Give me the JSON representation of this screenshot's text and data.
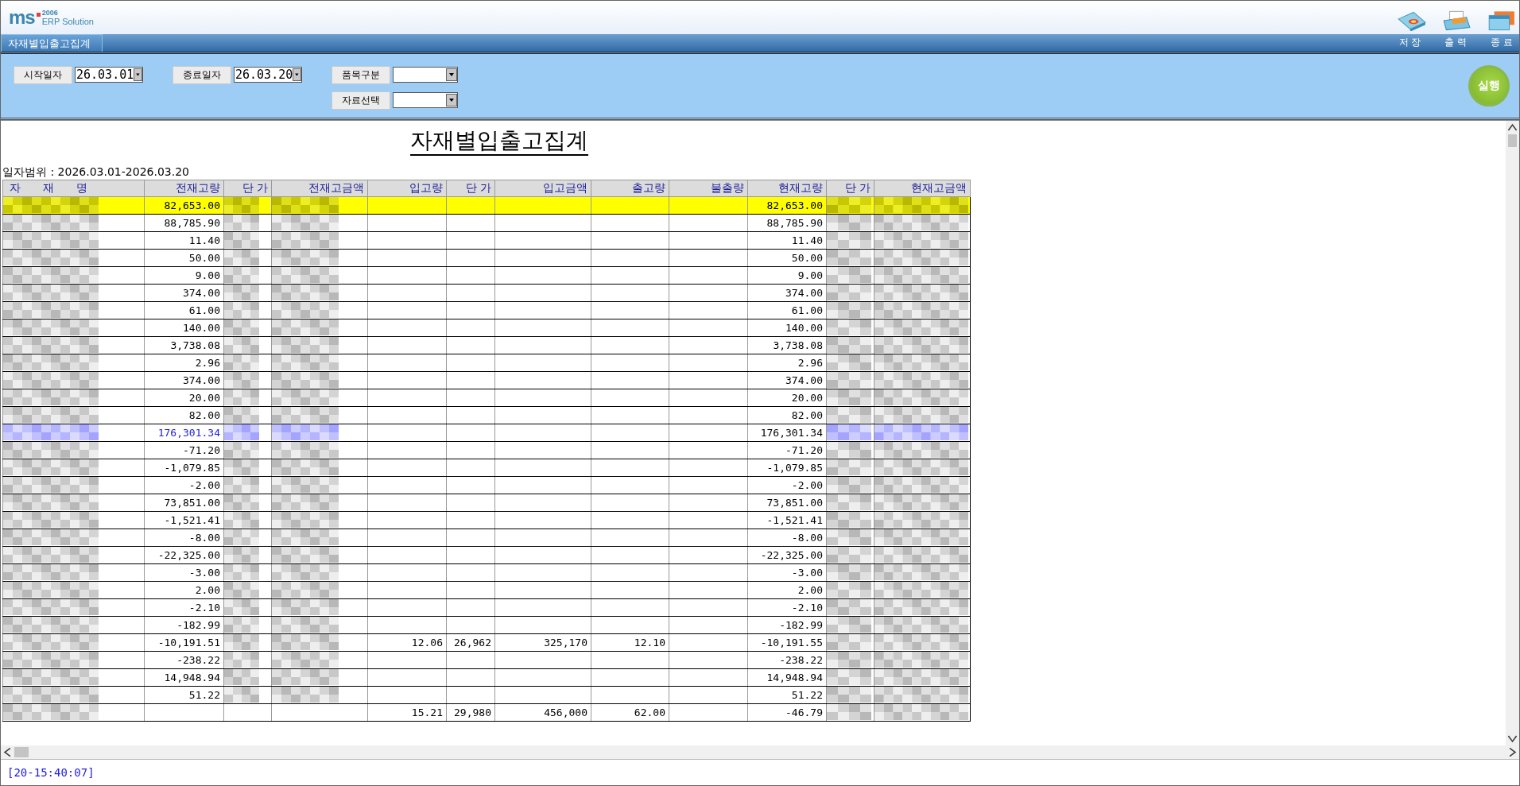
{
  "logo": {
    "mark": "ms",
    "year": "2006",
    "product": "ERP Solution"
  },
  "toolbar": [
    {
      "kind": "save",
      "label": "저 장"
    },
    {
      "kind": "print",
      "label": "출 력"
    },
    {
      "kind": "exit",
      "label": "종 료"
    }
  ],
  "tabs": [
    {
      "label": "자재별입출고집계",
      "selected": true
    }
  ],
  "filters": [
    {
      "label": "시작일자",
      "value": "26.03.01",
      "kind": "combo"
    },
    {
      "label": "종료일자",
      "value": "26.03.20",
      "kind": "combo"
    },
    {
      "label": "품목구분",
      "kind": "combo"
    },
    {
      "label": "자료선택",
      "kind": "combo"
    }
  ],
  "run_button": "실행",
  "report": {
    "title": "자재별입출고집계",
    "date_range": "일자범위 : 2026.03.01-2026.03.20",
    "columns": [
      "자　　재　　명",
      "전재고량",
      "단 가",
      "전재고금액",
      "입고량",
      "단 가",
      "입고금액",
      "출고량",
      "불출량",
      "현재고량",
      "단 가",
      "현재고금액"
    ],
    "rows": [
      {
        "selected": true,
        "kind": "item",
        "prev_qty": "82,653.00",
        "cur_qty": "82,653.00"
      },
      {
        "selected": false,
        "kind": "item",
        "prev_qty": "88,785.90",
        "cur_qty": "88,785.90"
      },
      {
        "selected": false,
        "kind": "item",
        "prev_qty": "11.40",
        "cur_qty": "11.40"
      },
      {
        "selected": false,
        "kind": "item",
        "prev_qty": "50.00",
        "cur_qty": "50.00"
      },
      {
        "selected": false,
        "kind": "item",
        "prev_qty": "9.00",
        "cur_qty": "9.00"
      },
      {
        "selected": false,
        "kind": "item",
        "prev_qty": "374.00",
        "cur_qty": "374.00"
      },
      {
        "selected": false,
        "kind": "item",
        "prev_qty": "61.00",
        "cur_qty": "61.00"
      },
      {
        "selected": false,
        "kind": "item",
        "prev_qty": "140.00",
        "cur_qty": "140.00"
      },
      {
        "selected": false,
        "kind": "item",
        "prev_qty": "3,738.08",
        "cur_qty": "3,738.08"
      },
      {
        "selected": false,
        "kind": "item",
        "prev_qty": "2.96",
        "cur_qty": "2.96"
      },
      {
        "selected": false,
        "kind": "item",
        "prev_qty": "374.00",
        "cur_qty": "374.00"
      },
      {
        "selected": false,
        "kind": "item",
        "prev_qty": "20.00",
        "cur_qty": "20.00"
      },
      {
        "selected": false,
        "kind": "item",
        "prev_qty": "82.00",
        "cur_qty": "82.00"
      },
      {
        "selected": false,
        "kind": "subtotal",
        "prev_qty": "176,301.34",
        "cur_qty": "176,301.34"
      },
      {
        "selected": false,
        "kind": "item",
        "prev_qty": "-71.20",
        "cur_qty": "-71.20"
      },
      {
        "selected": false,
        "kind": "item",
        "prev_qty": "-1,079.85",
        "cur_qty": "-1,079.85"
      },
      {
        "selected": false,
        "kind": "item",
        "prev_qty": "-2.00",
        "cur_qty": "-2.00"
      },
      {
        "selected": false,
        "kind": "item",
        "prev_qty": "73,851.00",
        "cur_qty": "73,851.00"
      },
      {
        "selected": false,
        "kind": "item",
        "prev_qty": "-1,521.41",
        "cur_qty": "-1,521.41"
      },
      {
        "selected": false,
        "kind": "item",
        "prev_qty": "-8.00",
        "cur_qty": "-8.00"
      },
      {
        "selected": false,
        "kind": "item",
        "prev_qty": "-22,325.00",
        "cur_qty": "-22,325.00"
      },
      {
        "selected": false,
        "kind": "item",
        "prev_qty": "-3.00",
        "cur_qty": "-3.00"
      },
      {
        "selected": false,
        "kind": "item",
        "prev_qty": "2.00",
        "cur_qty": "2.00"
      },
      {
        "selected": false,
        "kind": "item",
        "prev_qty": "-2.10",
        "cur_qty": "-2.10"
      },
      {
        "selected": false,
        "kind": "item",
        "prev_qty": "-182.99",
        "cur_qty": "-182.99"
      },
      {
        "selected": false,
        "kind": "item",
        "prev_qty": "-10,191.51",
        "in_qty": "12.06",
        "in_price": "26,962",
        "in_amount": "325,170",
        "out_qty": "12.10",
        "cur_qty": "-10,191.55"
      },
      {
        "selected": false,
        "kind": "item",
        "prev_qty": "-238.22",
        "cur_qty": "-238.22"
      },
      {
        "selected": false,
        "kind": "item",
        "prev_qty": "14,948.94",
        "cur_qty": "14,948.94"
      },
      {
        "selected": false,
        "kind": "item",
        "prev_qty": "51.22",
        "cur_qty": "51.22"
      },
      {
        "selected": false,
        "kind": "item",
        "in_qty": "15.21",
        "in_price": "29,980",
        "in_amount": "456,000",
        "out_qty": "62.00",
        "cur_qty": "-46.79"
      }
    ]
  },
  "status_bar": "[20-15:40:07]"
}
